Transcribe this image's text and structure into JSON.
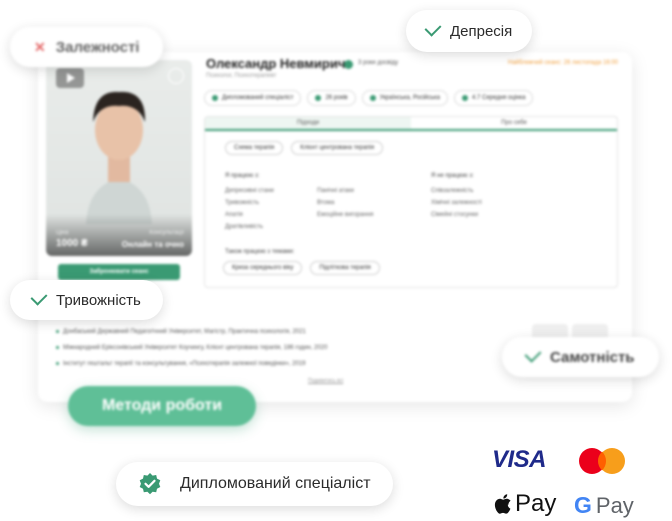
{
  "profile": {
    "name": "Олександр Невмирич",
    "experience": "3 роки досвіду",
    "role": "Психолог, Психотерапевт",
    "next_session": "Найближчий сеанс: 26 листопада 16:00",
    "price_caption": "Ціна",
    "price": "1000 ₴",
    "mode_caption": "Консультації",
    "mode": "Онлайн та очно",
    "book_button": "Забронювати сеанс",
    "chips": [
      "Дипломований спеціаліст",
      "26 років",
      "Українська, Російська",
      "4.7  Середня оцінка"
    ]
  },
  "tabs": {
    "items": [
      "Підходи",
      "Про себе"
    ],
    "active_index": 0
  },
  "methods": [
    "Схема терапія",
    "Клієнт центрована терапія"
  ],
  "works_with": {
    "title": "Я працюю з:",
    "col1": [
      "Депресивні стани",
      "Тривожність",
      "Апатія",
      "Дратівливість"
    ],
    "col2": [
      "Панічні атаки",
      "Втома",
      "Емоційне вигорання"
    ]
  },
  "not_works_with": {
    "title": "Я не працюю з:",
    "items": [
      "Співзалежність",
      "Хімічні залежності",
      "Сімейні стосунки"
    ]
  },
  "themes": {
    "title": "Також працюю з темами:",
    "items": [
      "Криза середнього віку",
      "Підліткова терапія"
    ]
  },
  "education": [
    "Донбаський Державний Педагогічний Університет, Магістр, Практична психологія, 2021",
    "Міжнародний Еріксонівський Університет Коучингу, Клієнт центрована терапія, 186 годин, 2020",
    "Інститут гештальт терапії та консультування, «Психотерапія залежної поведінки», 2019"
  ],
  "education_more": "Подивитись всі",
  "floating_tags": {
    "depresia": "Депресія",
    "zalezhnosti": "Залежності",
    "tryvozhnist": "Тривожність",
    "samotnist": "Самотність"
  },
  "methods_button": "Методи роботи",
  "certified_badge": "Дипломований спеціаліст",
  "payments": {
    "visa": "VISA",
    "apple_pay": "Pay",
    "google_pay": "Pay"
  },
  "colors": {
    "accent": "#3a9a73",
    "accent_light": "#5fbf97",
    "visa": "#1f2a8a",
    "warning": "#e46a6a"
  }
}
